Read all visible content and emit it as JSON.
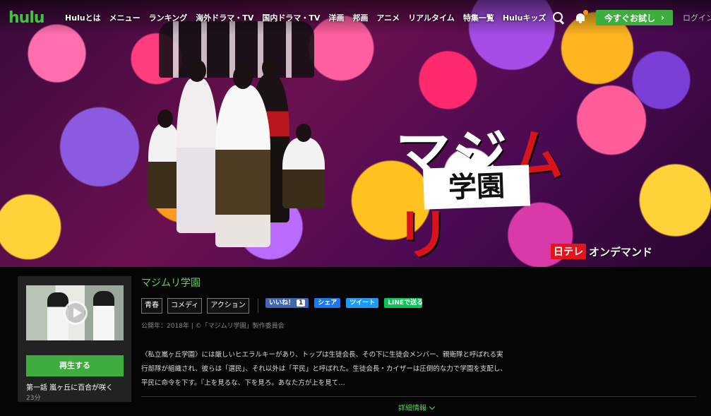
{
  "header": {
    "logo": "hulu",
    "nav": [
      "Huluとは",
      "メニュー",
      "ランキング",
      "海外ドラマ・TV",
      "国内ドラマ・TV",
      "洋画",
      "邦画",
      "アニメ",
      "リアルタイム",
      "特集一覧",
      "Huluキッズ"
    ],
    "trial_label": "今すぐお試し",
    "trial_arrow": "›",
    "login_label": "ログイン"
  },
  "hero": {
    "title_main_1": "マジ",
    "title_main_2": "ムリ",
    "title_sub": "学園",
    "network_box": "日テレ",
    "network_text": "オンデマンド"
  },
  "episode": {
    "play_label": "再生する",
    "title": "第一話 嵐ヶ丘に百合が咲く",
    "duration": "23分"
  },
  "show": {
    "title": "マジムリ学園",
    "genres": [
      "青春",
      "コメディ",
      "アクション"
    ],
    "meta": "公開年：2018年 | ©「マジムリ学園」製作委員会",
    "description": "〈私立嵐ヶ丘学園〉には厳しいヒエラルキーがあり、トップは生徒会長、その下に生徒会メンバー、親衛隊と呼ばれる実行部隊が組織され、彼らは「選民」、それ以外は「平民」と呼ばれた。生徒会長・カイザーは圧倒的な力で学園を支配し、平民に命令を下す。『上を見るな、下を見ろ。あなた方が上を見て…",
    "more_label": "詳細情報"
  },
  "social": {
    "like_label": "いいね！",
    "like_count": "1",
    "share_label": "シェア",
    "tweet_label": "ツイート",
    "line_label": "LINEで送る"
  }
}
